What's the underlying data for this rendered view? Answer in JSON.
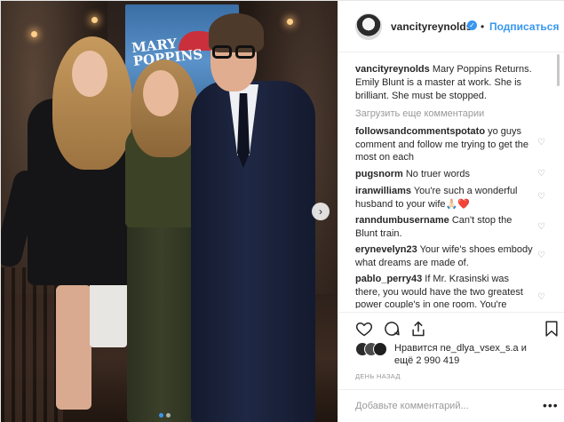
{
  "post": {
    "username": "vancityreynolds",
    "separator": "•",
    "follow_label": "Подписаться",
    "caption": "Mary Poppins Returns. Emily Blunt is a master at work. She is brilliant. She must be stopped.",
    "load_more": "Загрузить еще комментарии",
    "likes_line1": "Нравится ne_dlya_vsex_s.a и",
    "likes_line2": "ещё 2 990 419",
    "time": "ДЕНЬ НАЗАД",
    "add_comment_placeholder": "Добавьте комментарий...",
    "more": "•••"
  },
  "poster": {
    "title_line1": "MARY",
    "title_line2": "POPPINS"
  },
  "comments": [
    {
      "user": "followsandcommentspotato",
      "text": "yo guys comment and follow me trying to get the most on each"
    },
    {
      "user": "pugsnorm",
      "text": "No truer words"
    },
    {
      "user": "iranwilliams",
      "text": "You're such a wonderful husband to your wife🙏🏻❤️"
    },
    {
      "user": "ranndumbusername",
      "text": "Can't stop the Blunt train."
    },
    {
      "user": "erynevelyn23",
      "text": "Your wife's shoes embody what dreams are made of."
    },
    {
      "user": "pablo_perry43",
      "text": "If Mr. Krasinski was there, you would have the two greatest power couple's in one room. You're"
    }
  ],
  "icons": {
    "verified": "verified-badge-icon",
    "like": "heart-outline-icon",
    "comment": "speech-bubble-icon",
    "share": "share-arrow-icon",
    "save": "bookmark-icon",
    "next": "chevron-right-icon"
  },
  "colors": {
    "accent": "#3897f0",
    "muted": "#999999",
    "text": "#262626"
  }
}
